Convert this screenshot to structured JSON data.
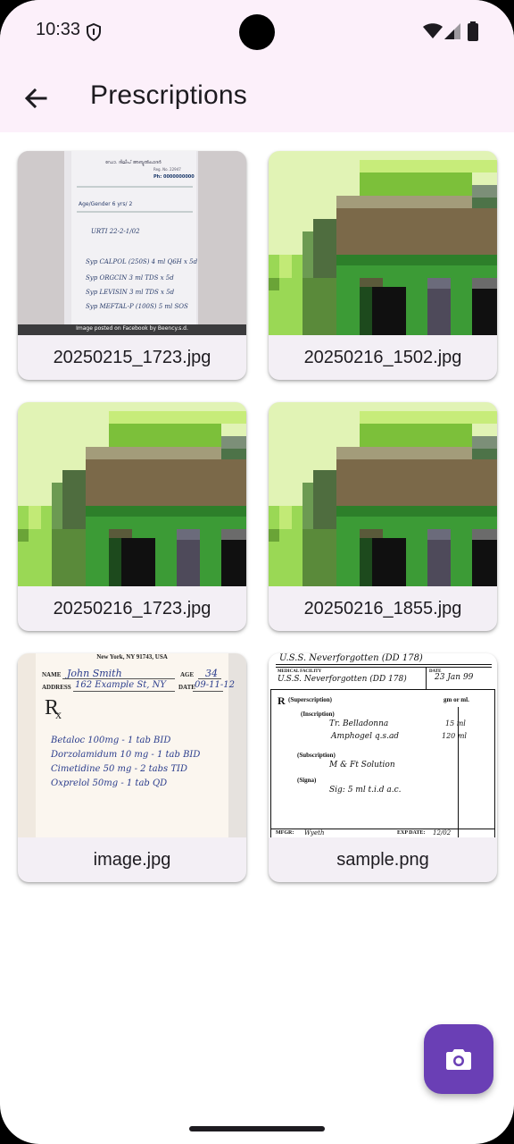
{
  "status_bar": {
    "time": "10:33",
    "icons": [
      "shield-icon",
      "wifi-icon",
      "signal-icon",
      "battery-icon"
    ]
  },
  "app_bar": {
    "back_icon": "arrow-back-icon",
    "title": "Prescriptions",
    "background": "#fcf0fa"
  },
  "images": [
    {
      "filename": "20250215_1723.jpg",
      "kind": "photo-prescription",
      "caption": "Image posted on Facebook by Beency.s.d.",
      "lines": [
        "Age/Gender 6 yrs/ 2",
        "URTI 22-2-1/02",
        "Syp CALPOL (250S) 4 ml Q6H x 5d",
        "Syp ORGCIN 3 ml TDS x 5d",
        "Syp LEVISIN 3 ml TDS x 5d",
        "Syp MEFTAL-P (100S) 5 ml SOS"
      ]
    },
    {
      "filename": "20250216_1502.jpg",
      "kind": "pixel-house"
    },
    {
      "filename": "20250216_1723.jpg",
      "kind": "pixel-house"
    },
    {
      "filename": "20250216_1855.jpg",
      "kind": "pixel-house"
    },
    {
      "filename": "image.jpg",
      "kind": "rx-form",
      "header": "New York, NY 91743, USA",
      "name_label": "NAME",
      "name_value": "John Smith",
      "age_label": "AGE",
      "age_value": "34",
      "address_label": "ADDRESS",
      "address_value": "162 Example St, NY",
      "date_label": "DATE",
      "date_value": "09-11-12",
      "rx_symbol": "R",
      "rx_lines": [
        "Betaloc 100mg - 1 tab BID",
        "Dorzolamidum 10 mg - 1 tab BID",
        "Cimetidine 50 mg - 2 tabs TID",
        "Oxprelol 50mg - 1 tab QD"
      ]
    },
    {
      "filename": "sample.png",
      "kind": "medical-form",
      "ship_top": "U.S.S. Neverforgotten (DD 178)",
      "facility_label": "MEDICAL FACILITY",
      "facility_value": "U.S.S. Neverforgotten (DD 178)",
      "date_label": "DATE",
      "date_value": "23 Jan 99",
      "rx_symbol": "R",
      "superscription": "(Superscription)",
      "units": "gm or ml.",
      "inscription": "(Inscription)",
      "inscription_line1": "Tr. Belladonna",
      "inscription_qty1": "15 ml",
      "inscription_line2": "Amphogel q.s.ad",
      "inscription_qty2": "120 ml",
      "subscription": "(Subscription)",
      "subscription_line": "M & Ft Solution",
      "signa": "(Signa)",
      "signa_line": "Sig: 5 ml t.i.d a.c.",
      "mfgr_label": "MFGR:",
      "mfgr_value": "Wyeth",
      "exp_label": "EXP DATE:",
      "exp_value": "12/02"
    }
  ],
  "fab": {
    "icon": "camera-icon",
    "color": "#6a3fb5"
  }
}
